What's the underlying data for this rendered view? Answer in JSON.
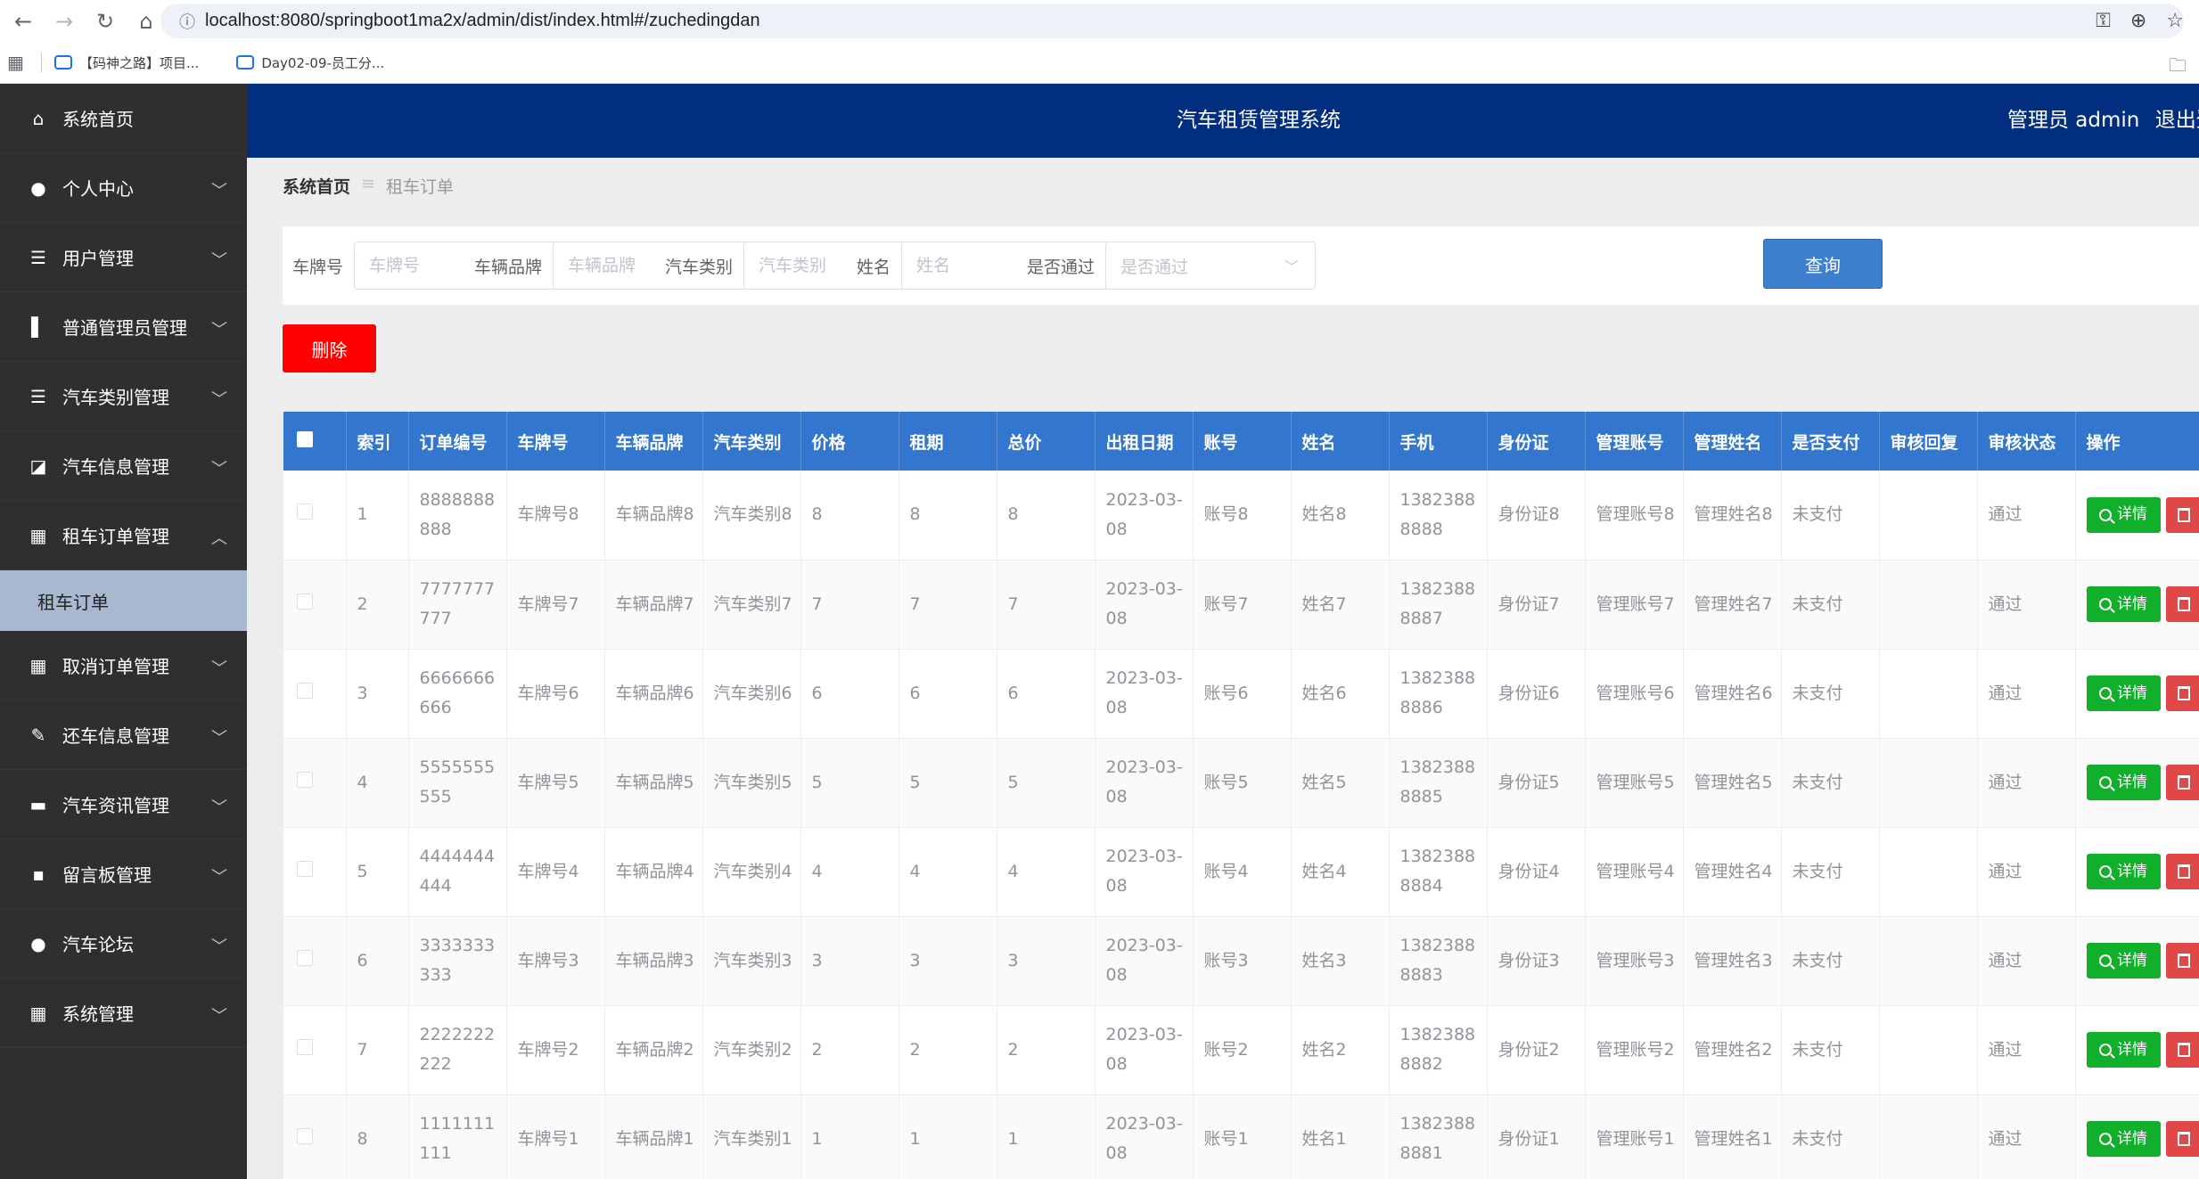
{
  "browser": {
    "url": "localhost:8080/springboot1ma2x/admin/dist/index.html#/zuchedingdan",
    "bookmarks": [
      "【码神之路】项目...",
      "Day02-09-员工分..."
    ]
  },
  "header": {
    "title": "汽车租赁管理系统",
    "user_text": "管理员 admin",
    "logout": "退出登"
  },
  "sidebar": {
    "items": [
      {
        "label": "系统首页",
        "icon": "home-icon",
        "expandable": false
      },
      {
        "label": "个人中心",
        "icon": "user-icon",
        "expandable": true
      },
      {
        "label": "用户管理",
        "icon": "list-icon",
        "expandable": true
      },
      {
        "label": "普通管理员管理",
        "icon": "book-icon",
        "expandable": true
      },
      {
        "label": "汽车类别管理",
        "icon": "list-icon",
        "expandable": true
      },
      {
        "label": "汽车信息管理",
        "icon": "chart-icon",
        "expandable": true
      },
      {
        "label": "租车订单管理",
        "icon": "grid-icon",
        "expandable": true,
        "expanded": true
      },
      {
        "label": "取消订单管理",
        "icon": "grid-icon",
        "expandable": true
      },
      {
        "label": "还车信息管理",
        "icon": "edit-icon",
        "expandable": true
      },
      {
        "label": "汽车资讯管理",
        "icon": "monitor-icon",
        "expandable": true
      },
      {
        "label": "留言板管理",
        "icon": "chat-icon",
        "expandable": true
      },
      {
        "label": "汽车论坛",
        "icon": "bulb-icon",
        "expandable": true
      },
      {
        "label": "系统管理",
        "icon": "grid-icon",
        "expandable": true
      }
    ],
    "submenu_active": "租车订单"
  },
  "breadcrumb": {
    "home": "系统首页",
    "separator": "≡",
    "current": "租车订单"
  },
  "search": {
    "fields": [
      {
        "label": "车牌号",
        "placeholder": "车牌号"
      },
      {
        "label": "车辆品牌",
        "placeholder": "车辆品牌"
      },
      {
        "label": "汽车类别",
        "placeholder": "汽车类别"
      },
      {
        "label": "姓名",
        "placeholder": "姓名"
      }
    ],
    "select": {
      "label": "是否通过",
      "placeholder": "是否通过"
    },
    "query_label": "查询"
  },
  "actions": {
    "delete_label": "删除"
  },
  "table": {
    "headers": [
      "索引",
      "订单编号",
      "车牌号",
      "车辆品牌",
      "汽车类别",
      "价格",
      "租期",
      "总价",
      "出租日期",
      "账号",
      "姓名",
      "手机",
      "身份证",
      "管理账号",
      "管理姓名",
      "是否支付",
      "审核回复",
      "审核状态",
      "操作"
    ],
    "detail_label": "详情",
    "rows": [
      [
        "1",
        "8888888888",
        "车牌号8",
        "车辆品牌8",
        "汽车类别8",
        "8",
        "8",
        "8",
        "2023-03-08",
        "账号8",
        "姓名8",
        "13823888888",
        "身份证8",
        "管理账号8",
        "管理姓名8",
        "未支付",
        "",
        "通过"
      ],
      [
        "2",
        "7777777777",
        "车牌号7",
        "车辆品牌7",
        "汽车类别7",
        "7",
        "7",
        "7",
        "2023-03-08",
        "账号7",
        "姓名7",
        "13823888887",
        "身份证7",
        "管理账号7",
        "管理姓名7",
        "未支付",
        "",
        "通过"
      ],
      [
        "3",
        "6666666666",
        "车牌号6",
        "车辆品牌6",
        "汽车类别6",
        "6",
        "6",
        "6",
        "2023-03-08",
        "账号6",
        "姓名6",
        "13823888886",
        "身份证6",
        "管理账号6",
        "管理姓名6",
        "未支付",
        "",
        "通过"
      ],
      [
        "4",
        "5555555555",
        "车牌号5",
        "车辆品牌5",
        "汽车类别5",
        "5",
        "5",
        "5",
        "2023-03-08",
        "账号5",
        "姓名5",
        "13823888885",
        "身份证5",
        "管理账号5",
        "管理姓名5",
        "未支付",
        "",
        "通过"
      ],
      [
        "5",
        "4444444444",
        "车牌号4",
        "车辆品牌4",
        "汽车类别4",
        "4",
        "4",
        "4",
        "2023-03-08",
        "账号4",
        "姓名4",
        "13823888884",
        "身份证4",
        "管理账号4",
        "管理姓名4",
        "未支付",
        "",
        "通过"
      ],
      [
        "6",
        "3333333333",
        "车牌号3",
        "车辆品牌3",
        "汽车类别3",
        "3",
        "3",
        "3",
        "2023-03-08",
        "账号3",
        "姓名3",
        "13823888883",
        "身份证3",
        "管理账号3",
        "管理姓名3",
        "未支付",
        "",
        "通过"
      ],
      [
        "7",
        "2222222222",
        "车牌号2",
        "车辆品牌2",
        "汽车类别2",
        "2",
        "2",
        "2",
        "2023-03-08",
        "账号2",
        "姓名2",
        "13823888882",
        "身份证2",
        "管理账号2",
        "管理姓名2",
        "未支付",
        "",
        "通过"
      ],
      [
        "8",
        "1111111111",
        "车牌号1",
        "车辆品牌1",
        "汽车类别1",
        "1",
        "1",
        "1",
        "2023-03-08",
        "账号1",
        "姓名1",
        "13823888881",
        "身份证1",
        "管理账号1",
        "管理姓名1",
        "未支付",
        "",
        "通过"
      ]
    ]
  },
  "colors": {
    "header_bg": "#012e7e",
    "sidebar_bg": "#2f2f2f",
    "table_header_bg": "#3376cd",
    "detail_button": "#11b02a",
    "delete_button": "#ff0000"
  }
}
